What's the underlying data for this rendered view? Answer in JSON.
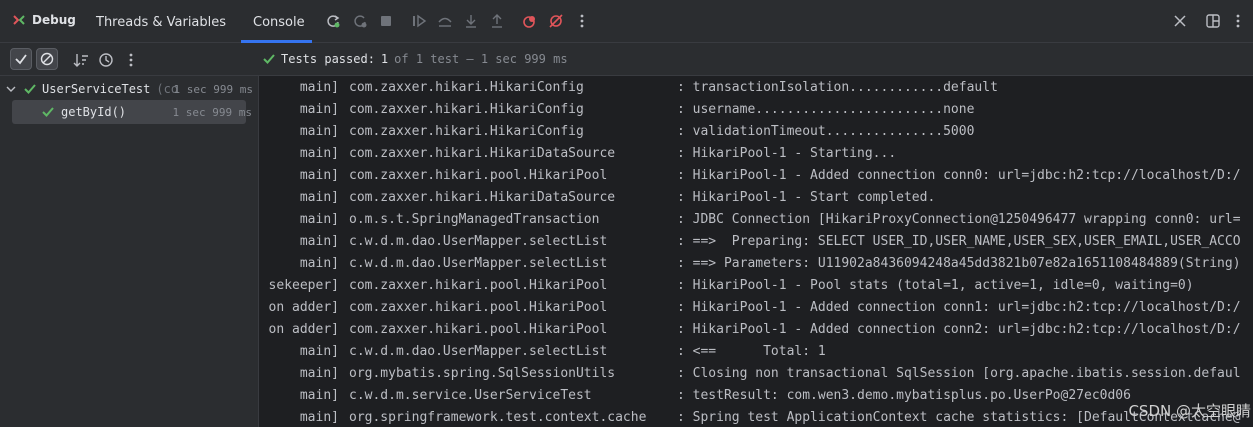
{
  "topbar": {
    "title": "Debug",
    "tabs": [
      "Threads & Variables",
      "Console"
    ],
    "active_tab": "Console"
  },
  "subbar": {
    "status_label": "Tests passed:",
    "status_count": "1",
    "status_rest": "of 1 test – 1 sec 999 ms"
  },
  "tree": {
    "root": {
      "name": "UserServiceTest",
      "suffix": "(co",
      "time": "1 sec 999 ms"
    },
    "child": {
      "name": "getById()",
      "time": "1 sec 999 ms"
    }
  },
  "console": {
    "lines": [
      {
        "thread": "main]",
        "logger": "com.zaxxer.hikari.HikariConfig",
        "msg": ": transactionIsolation............default"
      },
      {
        "thread": "main]",
        "logger": "com.zaxxer.hikari.HikariConfig",
        "msg": ": username........................none"
      },
      {
        "thread": "main]",
        "logger": "com.zaxxer.hikari.HikariConfig",
        "msg": ": validationTimeout...............5000"
      },
      {
        "thread": "main]",
        "logger": "com.zaxxer.hikari.HikariDataSource",
        "msg": ": HikariPool-1 - Starting..."
      },
      {
        "thread": "main]",
        "logger": "com.zaxxer.hikari.pool.HikariPool",
        "msg": ": HikariPool-1 - Added connection conn0: url=jdbc:h2:tcp://localhost/D:/"
      },
      {
        "thread": "main]",
        "logger": "com.zaxxer.hikari.HikariDataSource",
        "msg": ": HikariPool-1 - Start completed."
      },
      {
        "thread": "main]",
        "logger": "o.m.s.t.SpringManagedTransaction",
        "msg": ": JDBC Connection [HikariProxyConnection@1250496477 wrapping conn0: url="
      },
      {
        "thread": "main]",
        "logger": "c.w.d.m.dao.UserMapper.selectList",
        "msg": ": ==>  Preparing: SELECT USER_ID,USER_NAME,USER_SEX,USER_EMAIL,USER_ACCO"
      },
      {
        "thread": "main]",
        "logger": "c.w.d.m.dao.UserMapper.selectList",
        "msg": ": ==> Parameters: U11902a8436094248a45dd3821b07e82a1651108484889(String)"
      },
      {
        "thread": "sekeeper]",
        "logger": "com.zaxxer.hikari.pool.HikariPool",
        "msg": ": HikariPool-1 - Pool stats (total=1, active=1, idle=0, waiting=0)"
      },
      {
        "thread": "on adder]",
        "logger": "com.zaxxer.hikari.pool.HikariPool",
        "msg": ": HikariPool-1 - Added connection conn1: url=jdbc:h2:tcp://localhost/D:/"
      },
      {
        "thread": "on adder]",
        "logger": "com.zaxxer.hikari.pool.HikariPool",
        "msg": ": HikariPool-1 - Added connection conn2: url=jdbc:h2:tcp://localhost/D:/"
      },
      {
        "thread": "main]",
        "logger": "c.w.d.m.dao.UserMapper.selectList",
        "msg": ": <==      Total: 1"
      },
      {
        "thread": "main]",
        "logger": "org.mybatis.spring.SqlSessionUtils",
        "msg": ": Closing non transactional SqlSession [org.apache.ibatis.session.defaul"
      },
      {
        "thread": "main]",
        "logger": "c.w.d.m.service.UserServiceTest",
        "msg": ": testResult: com.wen3.demo.mybatisplus.po.UserPo@27ec0d06"
      },
      {
        "thread": "main]",
        "logger": "org.springframework.test.context.cache",
        "msg": ": Spring test ApplicationContext cache statistics: [DefaultContextCache@"
      }
    ]
  },
  "watermark": "CSDN @太空眼睛",
  "colors": {
    "accent": "#3574f0",
    "passed": "#5fb865",
    "stop": "#e0555a"
  }
}
